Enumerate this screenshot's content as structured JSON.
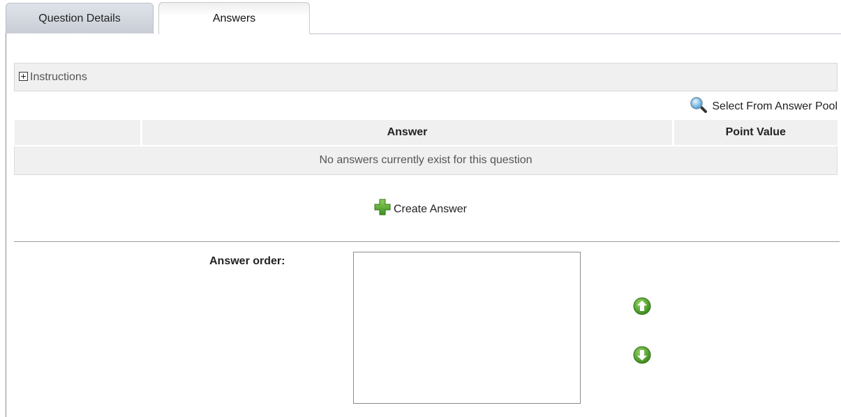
{
  "tabs": [
    {
      "label": "Question Details",
      "active": false
    },
    {
      "label": "Answers",
      "active": true
    }
  ],
  "instructions": {
    "label": "Instructions",
    "icon": "expand-plus-icon"
  },
  "answer_pool": {
    "label": "Select From Answer Pool",
    "icon": "magnifier-icon"
  },
  "answers_table": {
    "columns": [
      "",
      "Answer",
      "Point Value"
    ],
    "empty_message": "No answers currently exist for this question"
  },
  "create_answer": {
    "label": "Create Answer",
    "icon": "green-plus-icon"
  },
  "answer_order": {
    "label": "Answer order:",
    "items": []
  },
  "controls": {
    "move_up_icon": "arrow-up-icon",
    "move_down_icon": "arrow-down-icon"
  },
  "colors": {
    "panel_bg": "#f0f0f0",
    "arrow_green": "#4a9a2a",
    "tab_inactive": "#cfd4db"
  }
}
